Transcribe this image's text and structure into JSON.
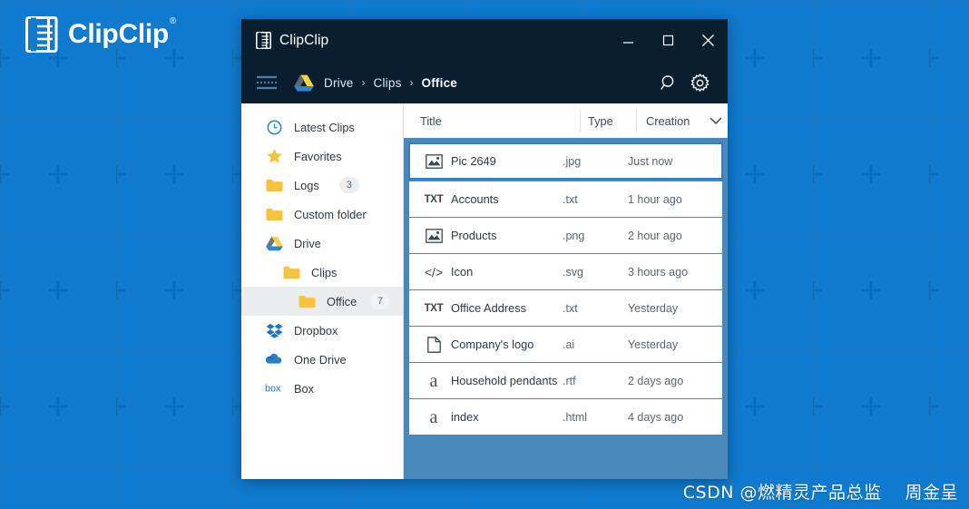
{
  "desktop": {
    "background_color": "#0F7ACE",
    "brand": {
      "name": "ClipClip",
      "registered_mark": "®",
      "logo_icon": "clipclip-logo-icon"
    },
    "watermark": {
      "prefix": "CSDN @燃精灵产品总监",
      "author": "周金呈"
    }
  },
  "window": {
    "titlebar": {
      "app_icon": "clipclip-app-icon",
      "title": "ClipClip",
      "minimize_label": "Minimize",
      "maximize_label": "Maximize",
      "close_label": "Close",
      "background_color": "#0B1E30"
    },
    "navbar": {
      "menu_icon": "hamburger-menu-icon",
      "drive_icon": "google-drive-icon",
      "breadcrumb": [
        "Drive",
        "Clips",
        "Office"
      ],
      "separator": "›",
      "search_icon": "search-icon",
      "settings_icon": "gear-icon"
    },
    "sidebar": {
      "items": [
        {
          "label": "Latest Clips",
          "icon": "clock-icon",
          "indent": 0,
          "badge": null,
          "active": false
        },
        {
          "label": "Favorites",
          "icon": "star-icon",
          "indent": 0,
          "badge": null,
          "active": false
        },
        {
          "label": "Logs",
          "icon": "folder-icon",
          "indent": 0,
          "badge": "3",
          "active": false
        },
        {
          "label": "Custom folder",
          "icon": "folder-icon",
          "indent": 0,
          "badge": null,
          "active": false
        },
        {
          "label": "Drive",
          "icon": "google-drive-icon",
          "indent": 0,
          "badge": null,
          "active": false
        },
        {
          "label": "Clips",
          "icon": "folder-icon",
          "indent": 1,
          "badge": null,
          "active": false
        },
        {
          "label": "Office",
          "icon": "folder-icon",
          "indent": 2,
          "badge": "7",
          "active": true
        },
        {
          "label": "Dropbox",
          "icon": "dropbox-icon",
          "indent": 0,
          "badge": null,
          "active": false
        },
        {
          "label": "One Drive",
          "icon": "onedrive-icon",
          "indent": 0,
          "badge": null,
          "active": false
        },
        {
          "label": "Box",
          "icon": "box-icon",
          "indent": 0,
          "badge": null,
          "active": false
        }
      ]
    },
    "file_list": {
      "columns": {
        "title": "Title",
        "type": "Type",
        "creation": "Creation",
        "sort_icon": "chevron-down-icon"
      },
      "rows": [
        {
          "icon": "image-file-icon",
          "title": "Pic 2649",
          "type": ".jpg",
          "creation": "Just now",
          "selected": true
        },
        {
          "icon": "txt-file-icon",
          "title": "Accounts",
          "type": ".txt",
          "creation": "1 hour ago",
          "selected": false
        },
        {
          "icon": "image-file-icon",
          "title": "Products",
          "type": ".png",
          "creation": "2 hour ago",
          "selected": false
        },
        {
          "icon": "code-file-icon",
          "title": "Icon",
          "type": ".svg",
          "creation": "3 hours ago",
          "selected": false
        },
        {
          "icon": "txt-file-icon",
          "title": "Office Address",
          "type": ".txt",
          "creation": "Yesterday",
          "selected": false
        },
        {
          "icon": "document-file-icon",
          "title": "Company's logo",
          "type": ".ai",
          "creation": "Yesterday",
          "selected": false
        },
        {
          "icon": "rtf-file-icon",
          "title": "Household pendants",
          "type": ".rtf",
          "creation": "2 days ago",
          "selected": false
        },
        {
          "icon": "rtf-file-icon",
          "title": "index",
          "type": ".html",
          "creation": "4 days ago",
          "selected": false
        }
      ]
    }
  }
}
